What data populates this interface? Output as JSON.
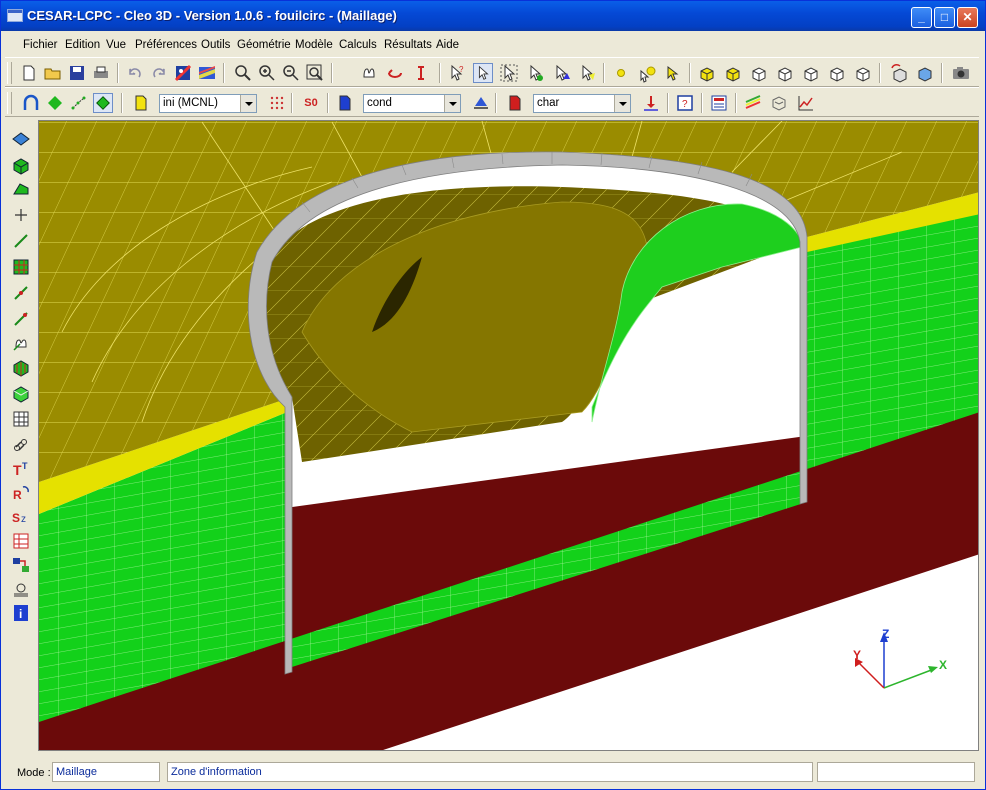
{
  "window": {
    "title": "CESAR-LCPC - Cleo 3D - Version 1.0.6 - fouilcirc - (Maillage)",
    "controls": {
      "minimize": "_",
      "maximize": "□",
      "close": "✕"
    }
  },
  "menu": [
    "Fichier",
    "Edition",
    "Vue",
    "Préférences",
    "Outils",
    "Géométrie",
    "Modèle",
    "Calculs",
    "Résultats",
    "Aide"
  ],
  "toolbar2": {
    "combo1": "ini (MCNL)",
    "s0_label": "S0",
    "combo2": "cond",
    "combo3": "char"
  },
  "axes": {
    "x": "X",
    "y": "Y",
    "z": "Z"
  },
  "status": {
    "mode_label": "Mode :",
    "mode_value": "Maillage",
    "info": "Zone d'information",
    "extra": ""
  },
  "colors": {
    "title_bar": "#0549d6",
    "soil_top": "#9a8c00",
    "soil_yellow": "#e5e100",
    "soil_green": "#13d11a",
    "soil_dark": "#6b0a0a",
    "wall": "#b9b9b9"
  }
}
